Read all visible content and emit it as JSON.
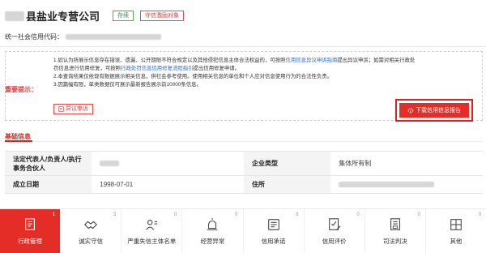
{
  "header": {
    "company_name": "县盐业专营公司",
    "status_tag": "存续",
    "credit_tag": "守信激励对象",
    "credit_code_label": "统一社会信用代码："
  },
  "notice": {
    "title": "重要提示：",
    "line1_a": "1.如认为所展示信息存在错误、遗漏、公开期限不符合规定以及其他侵犯信息主体合法权益的，可按照",
    "line1_link": "信用信息异议申诉指南",
    "line1_b": "提出异议申诉；如需对相关行政处",
    "line2_a": "罚信息进行信用修复，可按照",
    "line2_link": "行政处罚信息信用修复流程指引",
    "line2_b": "提出信用修复申请。",
    "line3": "2.本查询结果仅依现有数据展示相关信息，供社会参考使用。使用相关信息的单位和个人应对信息使用行为的合法性负责。",
    "line4": "3.因篇幅有限，单类数据仅可展示最新报告展示前10000条信息。",
    "dispute_button": "异议申诉",
    "download_button": "下载信用信息报告"
  },
  "basic_info": {
    "title": "基础信息",
    "rows": [
      {
        "label1": "法定代表人/负责人/执行事务合伙人",
        "value1": "",
        "label2": "企业类型",
        "value2": "集体所有制"
      },
      {
        "label1": "成立日期",
        "value1": "1998-07-01",
        "label2": "住所",
        "value2": ""
      }
    ]
  },
  "tabs": [
    {
      "label": "行政管理",
      "count": "1",
      "icon": "admin-doc-icon",
      "active": true
    },
    {
      "label": "诚实守信",
      "count": "3",
      "icon": "handshake-icon",
      "active": false
    },
    {
      "label": "严重失信主体名单",
      "count": "0",
      "icon": "person-list-icon",
      "active": false
    },
    {
      "label": "经营异常",
      "count": "0",
      "icon": "alarm-icon",
      "active": false
    },
    {
      "label": "信用承诺",
      "count": "8",
      "icon": "commitment-icon",
      "active": false
    },
    {
      "label": "信用评价",
      "count": "0",
      "icon": "evaluation-icon",
      "active": false
    },
    {
      "label": "司法判决",
      "count": "0",
      "icon": "judgment-icon",
      "active": false
    },
    {
      "label": "其他",
      "count": "0",
      "icon": "other-icon",
      "active": false
    }
  ],
  "colors": {
    "accent": "#e52d27",
    "link": "#2c6cd6",
    "tag_green": "#2e9b3e"
  }
}
